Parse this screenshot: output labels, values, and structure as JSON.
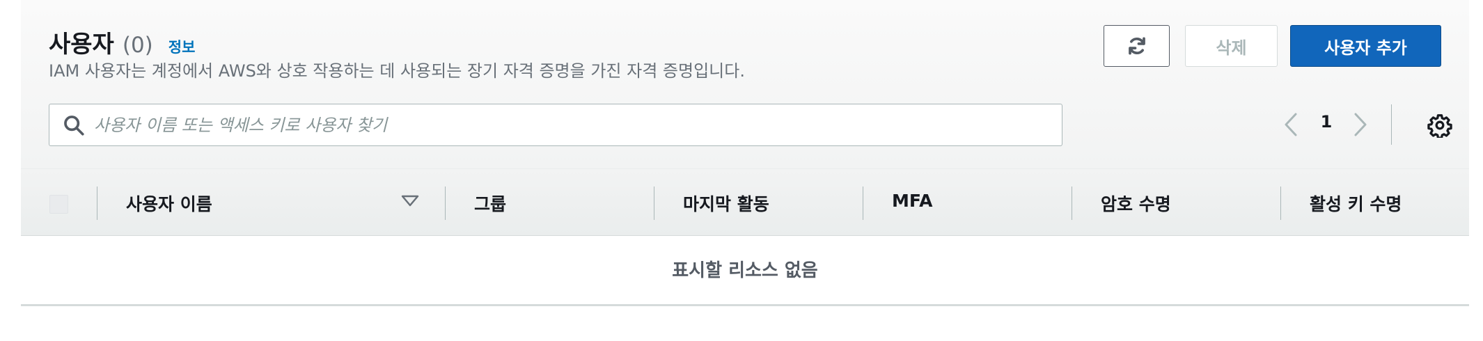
{
  "header": {
    "title": "사용자",
    "count": "(0)",
    "info_link": "정보",
    "description": "IAM 사용자는 계정에서 AWS와 상호 작용하는 데 사용되는 장기 자격 증명을 가진 자격 증명입니다."
  },
  "actions": {
    "refresh_icon": "refresh-icon",
    "delete_label": "삭제",
    "add_label": "사용자 추가"
  },
  "search": {
    "value": "",
    "placeholder": "사용자 이름 또는 액세스 키로 사용자 찾기"
  },
  "pagination": {
    "current_page": "1"
  },
  "table": {
    "columns": [
      "사용자 이름",
      "그룹",
      "마지막 활동",
      "MFA",
      "암호 수명",
      "활성 키 수명"
    ],
    "sorted_column": "사용자 이름",
    "sort_direction": "descending",
    "empty_message": "표시할 리소스 없음"
  },
  "colors": {
    "primary_button": "#1166bb",
    "link": "#0073bb",
    "muted_text": "#687078"
  }
}
